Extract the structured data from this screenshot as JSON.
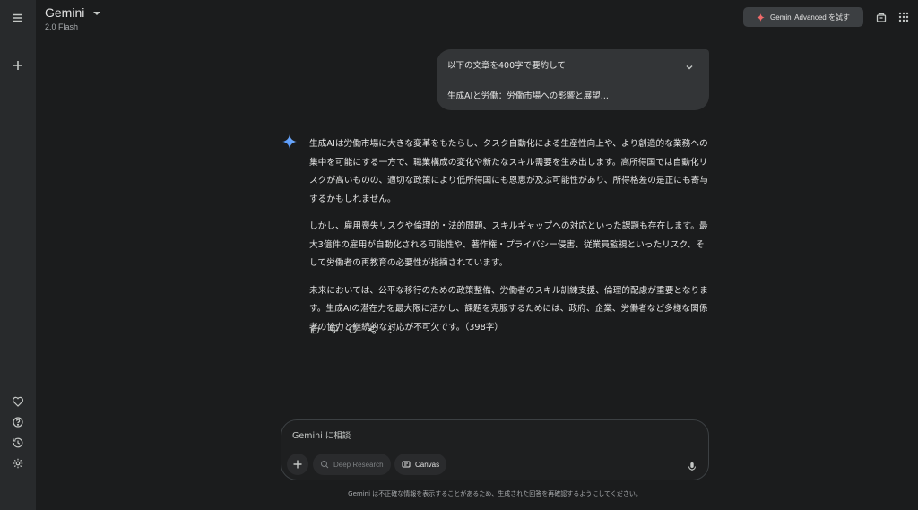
{
  "header": {
    "app_title": "Gemini",
    "model_name": "2.0 Flash",
    "advanced_button": "Gemini Advanced を試す"
  },
  "conversation": {
    "user_prompt_line1": "以下の文章を400字で要約して",
    "user_prompt_line2": "生成AIと労働：労働市場への影響と展望...",
    "response_paragraphs": [
      "生成AIは労働市場に大きな変革をもたらし、タスク自動化による生産性向上や、より創造的な業務への集中を可能にする一方で、職業構成の変化や新たなスキル需要を生み出します。高所得国では自動化リスクが高いものの、適切な政策により低所得国にも恩恵が及ぶ可能性があり、所得格差の是正にも寄与するかもしれません。",
      "しかし、雇用喪失リスクや倫理的・法的問題、スキルギャップへの対応といった課題も存在します。最大3億件の雇用が自動化される可能性や、著作権・プライバシー侵害、従業員監視といったリスク、そして労働者の再教育の必要性が指摘されています。",
      "未来においては、公平な移行のための政策整備、労働者のスキル訓練支援、倫理的配慮が重要となります。生成AIの潜在力を最大限に活かし、課題を克服するためには、政府、企業、労働者など多様な関係者の協力と継続的な対応が不可欠です。（398字）"
    ]
  },
  "composer": {
    "placeholder": "Gemini に相談",
    "deep_research_label": "Deep Research",
    "canvas_label": "Canvas"
  },
  "footer": {
    "disclaimer": "Gemini は不正確な情報を表示することがあるため、生成された回答を再確認するようにしてください。"
  },
  "colors": {
    "background": "#1b1c1d",
    "sidebar": "#282a2c",
    "bubble": "#333537",
    "accent_spark": "#4a8ef7"
  }
}
